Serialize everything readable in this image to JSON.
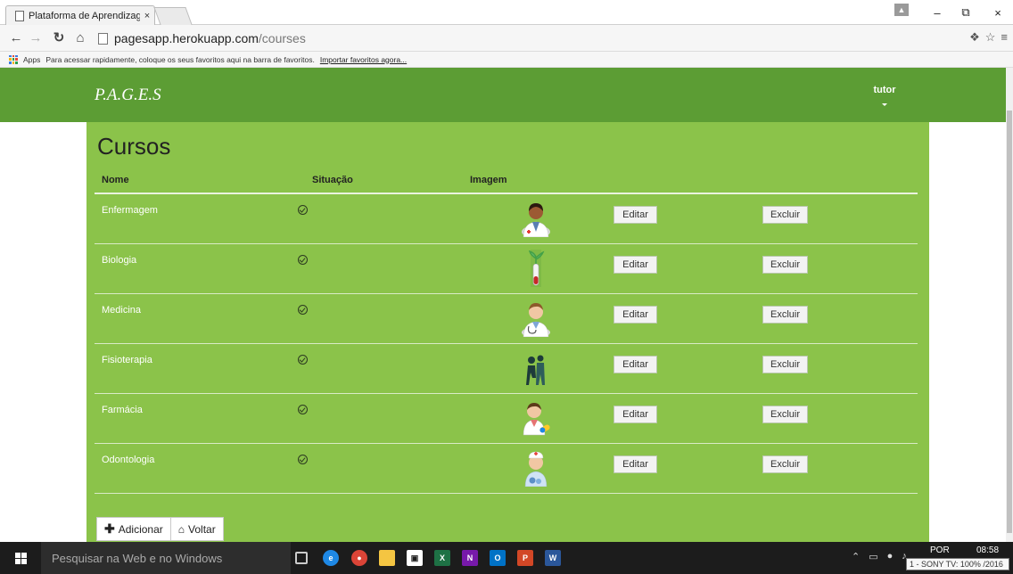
{
  "browser": {
    "tab_title": "Plataforma de Aprendizag",
    "tab_close": "×",
    "url_host": "pagesapp.herokuapp.com",
    "url_path": "/courses",
    "minimize": "–",
    "restore": "⧉",
    "close": "×"
  },
  "bookmarks": {
    "apps_label": "Apps",
    "hint": "Para acessar rapidamente, coloque os seus favoritos aqui na barra de favoritos.",
    "import_link": "Importar favoritos agora..."
  },
  "navbar": {
    "brand": "P.A.G.E.S",
    "user": "tutor"
  },
  "page": {
    "title": "Cursos",
    "columns": [
      "Nome",
      "Situação",
      "Imagem"
    ],
    "edit_label": "Editar",
    "delete_label": "Excluir",
    "add_label": "Adicionar",
    "back_label": "Voltar"
  },
  "courses": [
    {
      "name": "Enfermagem",
      "image": "nurse-doctor-icon"
    },
    {
      "name": "Biologia",
      "image": "test-tube-plant-icon"
    },
    {
      "name": "Medicina",
      "image": "doctor-stethoscope-icon"
    },
    {
      "name": "Fisioterapia",
      "image": "physiotherapy-icon"
    },
    {
      "name": "Farmácia",
      "image": "pharmacist-icon"
    },
    {
      "name": "Odontologia",
      "image": "dentist-nurse-icon"
    }
  ],
  "taskbar": {
    "search_placeholder": "Pesquisar na Web e no Windows",
    "language": "POR",
    "time": "08:58",
    "tooltip": "1 - SONY TV: 100%",
    "date_partial": "/2016"
  },
  "colors": {
    "navbar": "#5c9d34",
    "content": "#8bc34a"
  }
}
